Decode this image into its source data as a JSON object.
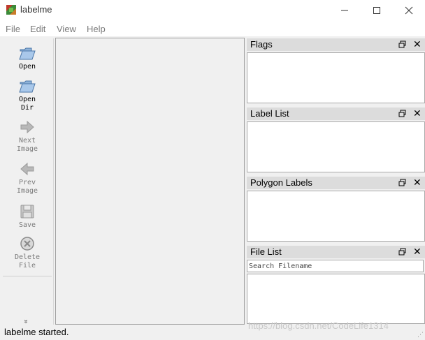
{
  "window": {
    "title": "labelme",
    "controls": {
      "minimize": "minimize-icon",
      "maximize": "maximize-icon",
      "close": "close-icon"
    }
  },
  "menu": {
    "items": [
      {
        "label": "File"
      },
      {
        "label": "Edit"
      },
      {
        "label": "View"
      },
      {
        "label": "Help"
      }
    ]
  },
  "toolbar": {
    "tools": [
      {
        "label": "Open",
        "icon": "folder-open-icon",
        "enabled": true
      },
      {
        "label": "Open\nDir",
        "icon": "folder-open-icon",
        "enabled": true
      },
      {
        "label": "Next\nImage",
        "icon": "arrow-right-icon",
        "enabled": false
      },
      {
        "label": "Prev\nImage",
        "icon": "arrow-left-icon",
        "enabled": false
      },
      {
        "label": "Save",
        "icon": "floppy-disk-icon",
        "enabled": false
      },
      {
        "label": "Delete\nFile",
        "icon": "delete-circle-icon",
        "enabled": false
      }
    ],
    "more": "»"
  },
  "docks": {
    "flags": {
      "title": "Flags"
    },
    "label_list": {
      "title": "Label List"
    },
    "polygon_labels": {
      "title": "Polygon Labels"
    },
    "file_list": {
      "title": "File List",
      "search_placeholder": "Search Filename"
    }
  },
  "status": {
    "text": "labelme started."
  },
  "watermark": "https://blog.csdn.net/CodeLife1314",
  "colors": {
    "window_bg": "#f0f0f0",
    "dock_title_bg": "#dcdcdc",
    "disabled_text": "#7a7a7a"
  }
}
